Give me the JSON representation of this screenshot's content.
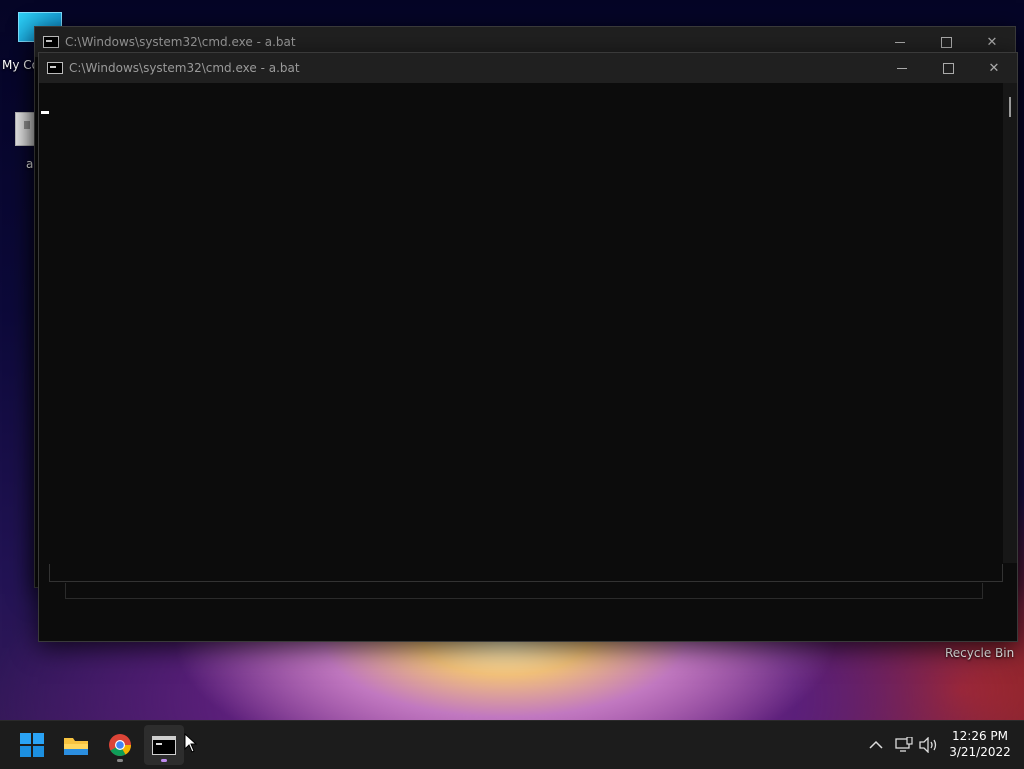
{
  "desktop": {
    "icons": [
      {
        "label": "My Co"
      },
      {
        "label": "a"
      },
      {
        "label": "Recycle Bin"
      }
    ]
  },
  "windows": [
    {
      "title": "C:\\Windows\\system32\\cmd.exe - a.bat"
    },
    {
      "title": "C:\\Windows\\system32\\cmd.exe - a.bat"
    }
  ],
  "taskbar": {
    "apps": [
      {
        "icon": "windows-start-icon"
      },
      {
        "icon": "file-explorer-icon"
      },
      {
        "icon": "chrome-icon"
      },
      {
        "icon": "command-prompt-icon"
      }
    ],
    "tray": {
      "icons": [
        "chevron-up-icon",
        "network-icon",
        "volume-icon"
      ],
      "time": "12:26 PM",
      "date": "3/21/2022"
    }
  },
  "colors": {
    "console_bg": "#0c0c0c",
    "titlebar_bg": "#202020",
    "taskbar_bg": "#1c1c1c",
    "accent": "#0078d4"
  }
}
